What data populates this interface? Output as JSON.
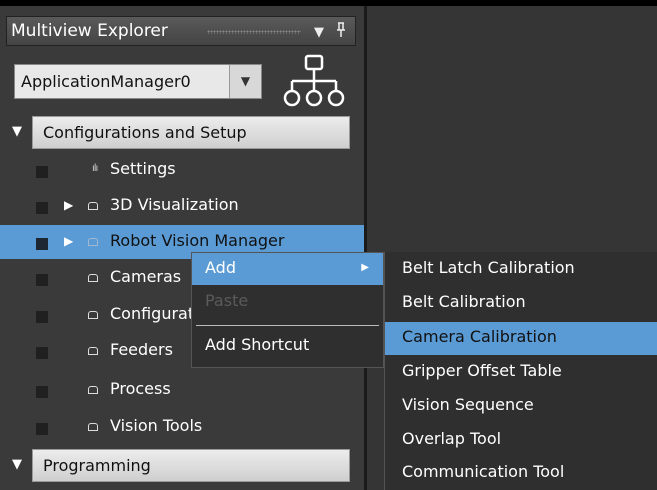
{
  "panel": {
    "title": "Multiview Explorer",
    "pin_icon": "pin-icon",
    "dropdown_icon": "triangle-down-icon"
  },
  "app_selector": {
    "value": "ApplicationManager0"
  },
  "hierarchy_icon": "hierarchy-icon",
  "groups": {
    "configurations": "Configurations and Setup",
    "programming": "Programming"
  },
  "tree": {
    "items": [
      {
        "label": "Settings"
      },
      {
        "label": "3D Visualization"
      },
      {
        "label": "Robot Vision Manager"
      },
      {
        "label": "Cameras"
      },
      {
        "label": "Configuration"
      },
      {
        "label": "Feeders"
      },
      {
        "label": "Process"
      },
      {
        "label": "Vision Tools"
      }
    ]
  },
  "context_menu": {
    "items": [
      {
        "label": "Add"
      },
      {
        "label": "Paste"
      },
      {
        "label": "Add Shortcut"
      }
    ]
  },
  "submenu": {
    "items": [
      {
        "label": "Belt Latch Calibration"
      },
      {
        "label": "Belt Calibration"
      },
      {
        "label": "Camera Calibration"
      },
      {
        "label": "Gripper Offset Table"
      },
      {
        "label": "Vision Sequence"
      },
      {
        "label": "Overlap Tool"
      },
      {
        "label": "Communication Tool"
      }
    ]
  },
  "colors": {
    "highlight": "#5b9bd5",
    "background": "#353535"
  }
}
